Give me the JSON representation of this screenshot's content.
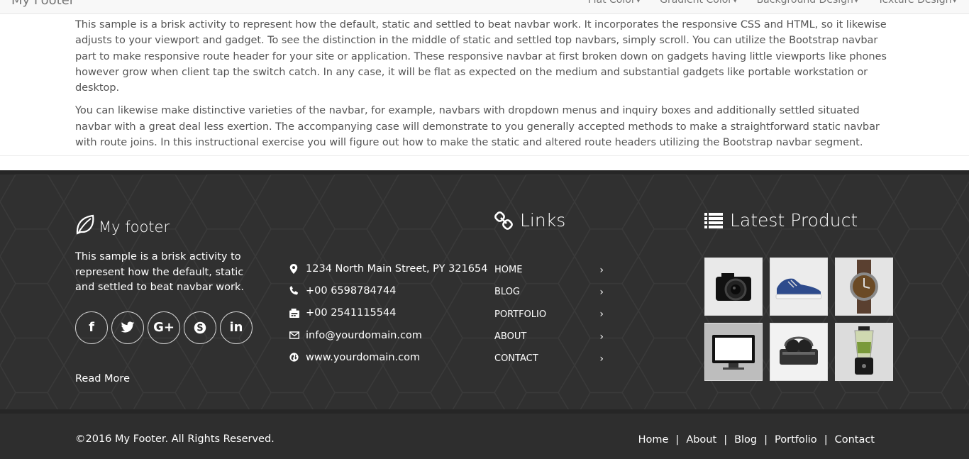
{
  "navbar": {
    "brand": "My Footer",
    "menu": [
      "Flat Color",
      "Gradient Color",
      "Background Design",
      "Texture Design"
    ]
  },
  "content": {
    "paragraphs": [
      "This sample is a brisk activity to represent how the default, static and settled to beat navbar work. It incorporates the responsive CSS and HTML, so it likewise adjusts to your viewport and gadget. To see the distinction in the middle of static and settled top navbars, simply scroll. You can utilize the Bootstrap navbar part to make responsive route header for your site or application. These responsive navbar at first broken down on gadgets having little viewports like phones however grow when client tap the switch catch. In any case, it will be flat as expected on the medium and substantial gadgets like portable workstation or desktop.",
      "You can likewise make distinctive varieties of the navbar, for example, navbars with dropdown menus and inquiry boxes and additionally settled situated navbar with a great deal less exertion. The accompanying case will demonstrate to you generally accepted methods to make a straightforward static navbar with route joins. In this instructional exercise you will figure out how to make the static and altered route headers utilizing the Bootstrap navbar segment."
    ]
  },
  "footer": {
    "brand": {
      "title": "My footer",
      "icon": "leaf-icon",
      "description": "This sample is a brisk activity to represent how the default, static and settled to beat navbar work.",
      "read_more": "Read More"
    },
    "social": [
      {
        "icon": "facebook-icon",
        "glyph": "f"
      },
      {
        "icon": "twitter-icon",
        "glyph": "t"
      },
      {
        "icon": "google-plus-icon",
        "glyph": "G+"
      },
      {
        "icon": "skype-icon",
        "glyph": "S"
      },
      {
        "icon": "linkedin-icon",
        "glyph": "in"
      }
    ],
    "contact": [
      {
        "icon": "map-marker-icon",
        "text": "1234 North Main Street, PY 321654"
      },
      {
        "icon": "phone-icon",
        "text": "+00 6598784744"
      },
      {
        "icon": "fax-icon",
        "text": "+00 2541115544"
      },
      {
        "icon": "envelope-icon",
        "text": "info@yourdomain.com"
      },
      {
        "icon": "globe-icon",
        "text": "www.yourdomain.com"
      }
    ],
    "links": {
      "heading": "Links",
      "icon": "link-icon",
      "items": [
        "HOME",
        "BLOG",
        "PORTFOLIO",
        "ABOUT",
        "CONTACT"
      ]
    },
    "products": {
      "heading": "Latest Product",
      "icon": "list-icon",
      "items": [
        "camera-image",
        "shoe-image",
        "watch-image",
        "monitor-image",
        "headphones-image",
        "blender-image"
      ]
    },
    "bottom": {
      "copyright": "©2016 My Footer. All Rights Reserved.",
      "links": [
        "Home",
        "About",
        "Blog",
        "Portfolio",
        "Contact"
      ]
    }
  },
  "colors": {
    "footer_bg": "#303030",
    "footer_border": "#262626",
    "text_muted": "#555555"
  }
}
